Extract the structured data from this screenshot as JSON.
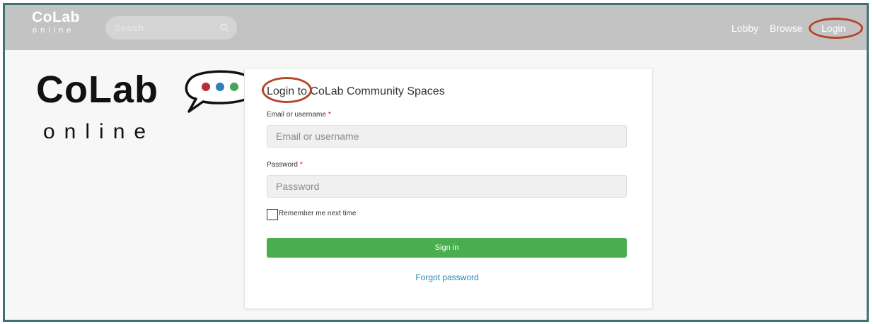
{
  "navbar": {
    "logo_main": "CoLab",
    "logo_sub": "online",
    "search_placeholder": "Search",
    "links": [
      "Lobby",
      "Browse",
      "Login"
    ]
  },
  "brand": {
    "main": "CoLab",
    "sub": "online"
  },
  "login_form": {
    "title": "Login to CoLab Community Spaces",
    "email_label": "Email or username",
    "email_placeholder": "Email or username",
    "password_label": "Password",
    "password_placeholder": "Password",
    "required_marker": "*",
    "remember_label": "Remember me next time",
    "signin_label": "Sign in",
    "forgot_label": "Forgot password"
  },
  "colors": {
    "frame": "#3f6f78",
    "navbar": "#c3c3c3",
    "highlight_ring": "#b5452b",
    "signin": "#4aad4f",
    "link": "#2a86b4",
    "bubble_dots": [
      "#b72e3a",
      "#2f7fb8",
      "#4aa35a"
    ]
  }
}
